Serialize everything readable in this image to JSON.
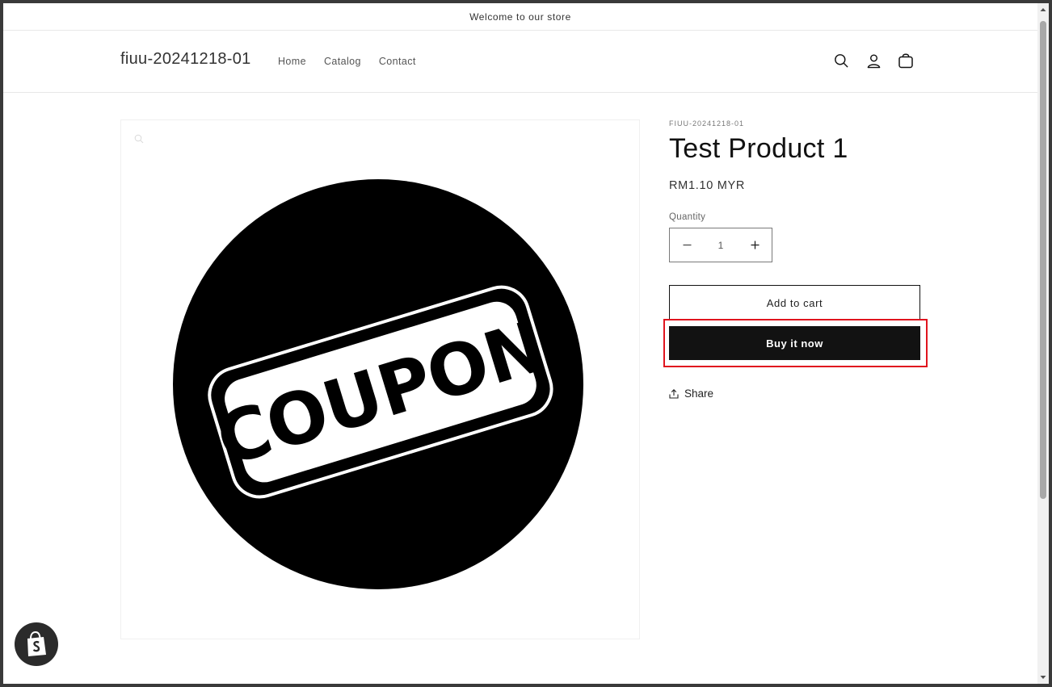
{
  "announcement": {
    "text": "Welcome to our store"
  },
  "header": {
    "brand": "fiuu-20241218-01",
    "nav": [
      {
        "label": "Home"
      },
      {
        "label": "Catalog"
      },
      {
        "label": "Contact"
      }
    ],
    "icons": [
      "search-icon",
      "account-icon",
      "cart-icon"
    ]
  },
  "product": {
    "image_text": "COUPON",
    "vendor": "FIUU-20241218-01",
    "title": "Test Product 1",
    "price": "RM1.10 MYR",
    "quantity_label": "Quantity",
    "quantity_value": "1",
    "add_to_cart_label": "Add to cart",
    "buy_now_label": "Buy it now",
    "share_label": "Share"
  },
  "colors": {
    "primary": "#121212",
    "highlight": "#e0141e",
    "background": "#ffffff"
  }
}
